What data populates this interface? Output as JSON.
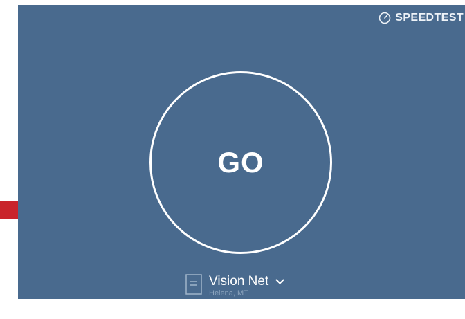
{
  "brand": {
    "name": "SPEEDTEST",
    "icon": "speedometer-icon"
  },
  "go_button": {
    "label": "GO"
  },
  "server": {
    "name": "Vision Net",
    "location": "Helena, MT",
    "icon": "server-icon",
    "dropdown_icon": "chevron-down-icon"
  },
  "colors": {
    "panel_background": "#496a8e",
    "accent_marker": "#c9242b",
    "foreground": "#ffffff"
  }
}
